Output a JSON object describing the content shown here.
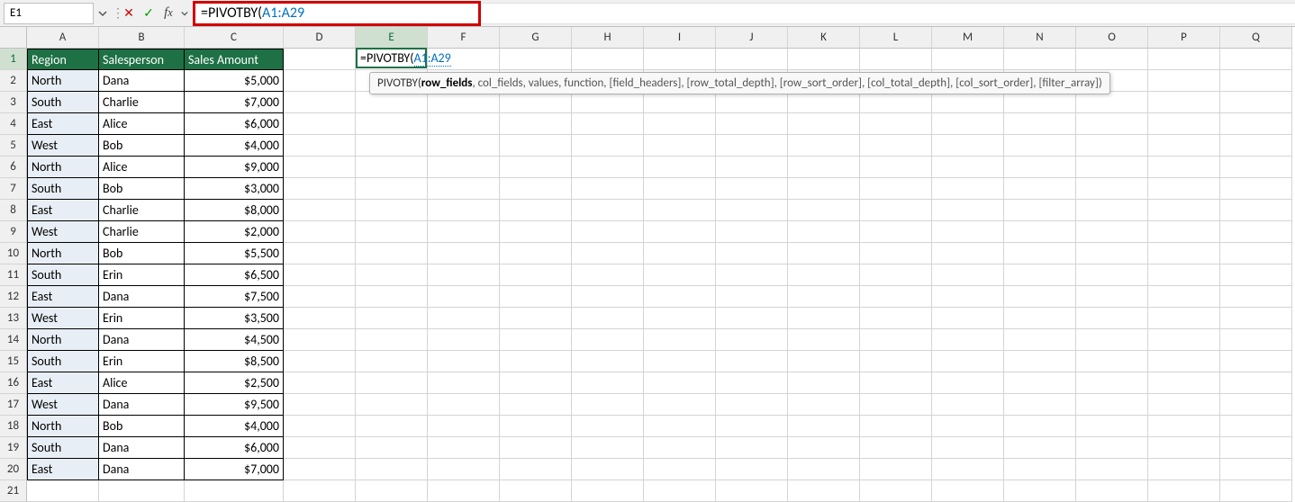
{
  "nameBox": "E1",
  "formulaBar": {
    "prefix": "=PIVOTBY(",
    "ref": "A1:A29"
  },
  "activeCell": {
    "prefix": "=PIVOTBY(",
    "ref": "A1:A29"
  },
  "tooltip": {
    "fn": "PIVOTBY(",
    "currentArg": "row_fields",
    "restArgs": ", col_fields, values, function, [field_headers], [row_total_depth], [row_sort_order], [col_total_depth], [col_sort_order], [filter_array])"
  },
  "columns": [
    "A",
    "B",
    "C",
    "D",
    "E",
    "F",
    "G",
    "H",
    "I",
    "J",
    "K",
    "L",
    "M",
    "N",
    "O",
    "P",
    "Q"
  ],
  "rowCount": 21,
  "activeColumn": "E",
  "activeRow": 1,
  "table": {
    "headers": [
      "Region",
      "Salesperson",
      "Sales Amount"
    ],
    "rows": [
      [
        "North",
        "Dana",
        "$5,000"
      ],
      [
        "South",
        "Charlie",
        "$7,000"
      ],
      [
        "East",
        "Alice",
        "$6,000"
      ],
      [
        "West",
        "Bob",
        "$4,000"
      ],
      [
        "North",
        "Alice",
        "$9,000"
      ],
      [
        "South",
        "Bob",
        "$3,000"
      ],
      [
        "East",
        "Charlie",
        "$8,000"
      ],
      [
        "West",
        "Charlie",
        "$2,000"
      ],
      [
        "North",
        "Bob",
        "$5,500"
      ],
      [
        "South",
        "Erin",
        "$6,500"
      ],
      [
        "East",
        "Dana",
        "$7,500"
      ],
      [
        "West",
        "Erin",
        "$3,500"
      ],
      [
        "North",
        "Dana",
        "$4,500"
      ],
      [
        "South",
        "Erin",
        "$8,500"
      ],
      [
        "East",
        "Alice",
        "$2,500"
      ],
      [
        "West",
        "Dana",
        "$9,500"
      ],
      [
        "North",
        "Bob",
        "$4,000"
      ],
      [
        "South",
        "Dana",
        "$6,000"
      ],
      [
        "East",
        "Dana",
        "$7,000"
      ]
    ]
  }
}
